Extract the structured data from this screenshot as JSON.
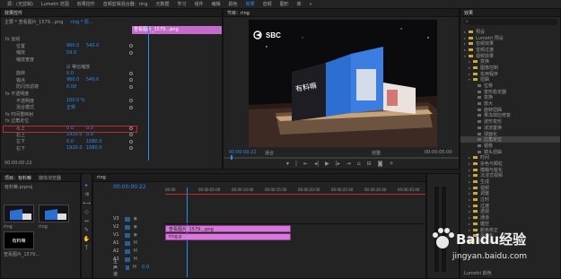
{
  "menu": {
    "items": [
      "源：(无剪辑)",
      "Lumetri 范围",
      "效果控件",
      "音频剪辑混合器：ring",
      "元数据",
      "学习",
      "组件",
      "编辑",
      "颜色",
      "效果",
      "音频",
      "图形",
      "库",
      "»"
    ],
    "active_index": 9
  },
  "effect_controls": {
    "tab_label": "效果控件",
    "header_clip": "ring * 原…",
    "master_path": "主要 * 查看图片_1579…png",
    "motion_label": "运动",
    "rows": [
      {
        "label": "fx 运动",
        "v1": "",
        "v2": ""
      },
      {
        "label": "位置",
        "v1": "960.0",
        "v2": "540.0"
      },
      {
        "label": "缩放",
        "v1": "59.0",
        "v2": ""
      },
      {
        "label": "缩放宽度",
        "v1": "",
        "v2": ""
      },
      {
        "label": "",
        "v1": "☑ 等比缩放",
        "v2": ""
      },
      {
        "label": "旋转",
        "v1": "0.0",
        "v2": ""
      },
      {
        "label": "锚点",
        "v1": "960.0",
        "v2": "540.0"
      },
      {
        "label": "防闪烁滤镜",
        "v1": "0.00",
        "v2": ""
      },
      {
        "label": "fx 不透明度",
        "v1": "",
        "v2": ""
      },
      {
        "label": "不透明度",
        "v1": "100.0 %",
        "v2": ""
      },
      {
        "label": "混合模式",
        "v1": "正常",
        "v2": ""
      },
      {
        "label": "fx 时间重映射",
        "v1": "",
        "v2": ""
      },
      {
        "label": "fx 边角定位",
        "v1": "",
        "v2": ""
      },
      {
        "label": "左上",
        "v1": "0.0",
        "v2": "0.0"
      },
      {
        "label": "右上",
        "v1": "1920.0",
        "v2": "0.0"
      },
      {
        "label": "左下",
        "v1": "0.0",
        "v2": "1080.0"
      },
      {
        "label": "右下",
        "v1": "1920.0",
        "v2": "1080.0"
      }
    ],
    "highlight_label": "fx 边角定位",
    "timecode": "00:00:00:22",
    "clip_bar_label": "查看图片_1579…png"
  },
  "program": {
    "tab_label": "节目：ring",
    "logo_text": "SBC",
    "billboard_text": "有料嘛",
    "timecode_left": "00:00:00:22",
    "fit_label": "适合",
    "quality_label": "完整",
    "timecode_right": "00:00:05:00"
  },
  "effects": {
    "tab_label": "效果",
    "search_placeholder": "",
    "items": [
      {
        "label": "预设",
        "indent": 0,
        "open": false
      },
      {
        "label": "Lumetri 预设",
        "indent": 0,
        "open": false
      },
      {
        "label": "音频效果",
        "indent": 0,
        "open": false
      },
      {
        "label": "音频过渡",
        "indent": 0,
        "open": false
      },
      {
        "label": "视频效果",
        "indent": 0,
        "open": true
      },
      {
        "label": "变换",
        "indent": 1,
        "open": false
      },
      {
        "label": "图像控制",
        "indent": 1,
        "open": false
      },
      {
        "label": "实用程序",
        "indent": 1,
        "open": false
      },
      {
        "label": "扭曲",
        "indent": 1,
        "open": true
      },
      {
        "label": "位移",
        "indent": 2,
        "open": false
      },
      {
        "label": "变形稳定器",
        "indent": 2,
        "open": false
      },
      {
        "label": "变换",
        "indent": 2,
        "open": false
      },
      {
        "label": "放大",
        "indent": 2,
        "open": false
      },
      {
        "label": "旋转扭曲",
        "indent": 2,
        "open": false
      },
      {
        "label": "果冻效应修复",
        "indent": 2,
        "open": false
      },
      {
        "label": "波形变形",
        "indent": 2,
        "open": false
      },
      {
        "label": "湍流置换",
        "indent": 2,
        "open": false
      },
      {
        "label": "球面化",
        "indent": 2,
        "open": false
      },
      {
        "label": "边角定位",
        "indent": 2,
        "open": false,
        "selected": true
      },
      {
        "label": "镜像",
        "indent": 2,
        "open": false
      },
      {
        "label": "镜头扭曲",
        "indent": 2,
        "open": false
      },
      {
        "label": "时间",
        "indent": 1,
        "open": false
      },
      {
        "label": "杂色与颗粒",
        "indent": 1,
        "open": false
      },
      {
        "label": "模糊与锐化",
        "indent": 1,
        "open": false
      },
      {
        "label": "沉浸式视频",
        "indent": 1,
        "open": false
      },
      {
        "label": "生成",
        "indent": 1,
        "open": false
      },
      {
        "label": "视频",
        "indent": 1,
        "open": false
      },
      {
        "label": "调整",
        "indent": 1,
        "open": false
      },
      {
        "label": "过时",
        "indent": 1,
        "open": false
      },
      {
        "label": "过渡",
        "indent": 1,
        "open": false
      },
      {
        "label": "透视",
        "indent": 1,
        "open": false
      },
      {
        "label": "通道",
        "indent": 1,
        "open": false
      },
      {
        "label": "键控",
        "indent": 1,
        "open": false
      },
      {
        "label": "颜色校正",
        "indent": 1,
        "open": false
      },
      {
        "label": "风格化",
        "indent": 1,
        "open": false
      },
      {
        "label": "视频过渡",
        "indent": 0,
        "open": false
      }
    ],
    "footer_label": "Lumetri 颜色"
  },
  "project": {
    "tabs": [
      "项目：有料嘛",
      "媒体浏览器"
    ],
    "path": "有料嘛.prproj",
    "thumbs": [
      {
        "name": "ring"
      },
      {
        "name": "ring"
      },
      {
        "name": "有料嘛"
      }
    ],
    "thumb_caption": "查看图片_1579…"
  },
  "timeline": {
    "tab_label": "ring",
    "timecode": "00:00:00:22",
    "ruler": [
      "00:00",
      "00:00:05:00",
      "00:00:10:00",
      "00:00:15:00",
      "00:00:20:00",
      "00:00:25:00",
      "00:00:30:00",
      "00:00:35:00"
    ],
    "tracks": [
      "V3",
      "V2",
      "V1",
      "A1",
      "A2",
      "A3",
      "主声道"
    ],
    "master_value": "0.0",
    "clip_v2_label": "查看图片_1579…png",
    "clip_v1_label": "ring.p"
  },
  "watermark": {
    "brand": "Baidu经验",
    "url": "jingyan.baidu.com"
  }
}
